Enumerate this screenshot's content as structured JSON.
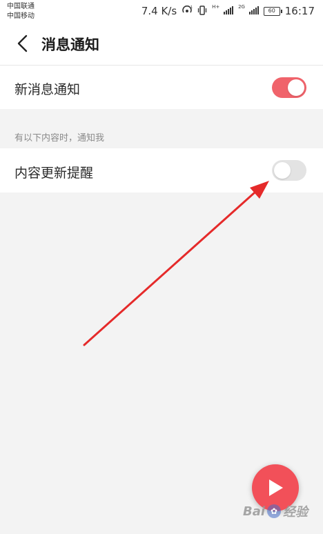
{
  "status_bar": {
    "carrier_1": "中国联通",
    "carrier_2": "中国移动",
    "net_speed": "7.4 K/s",
    "network_1": "H+",
    "network_2": "2G",
    "battery": "60",
    "time": "16:17",
    "icons": [
      "hotspot-icon",
      "vibrate-icon",
      "signal-icon",
      "signal-icon",
      "battery-icon"
    ]
  },
  "header": {
    "back_icon": "back-chevron-icon",
    "title": "消息通知"
  },
  "settings": {
    "new_message": {
      "label": "新消息通知",
      "enabled": true
    },
    "section_hint": "有以下内容时，通知我",
    "content_update": {
      "label": "内容更新提醒",
      "enabled": false
    }
  },
  "colors": {
    "accent": "#f0636b",
    "toggle_off": "#e3e3e3",
    "background": "#f3f3f3",
    "annotation_arrow": "#e52a2a",
    "fab": "#f25059"
  },
  "floating_button": {
    "icon": "play-icon"
  },
  "watermark": {
    "text": "Bai",
    "text2": "经验",
    "icon": "paw-icon"
  }
}
